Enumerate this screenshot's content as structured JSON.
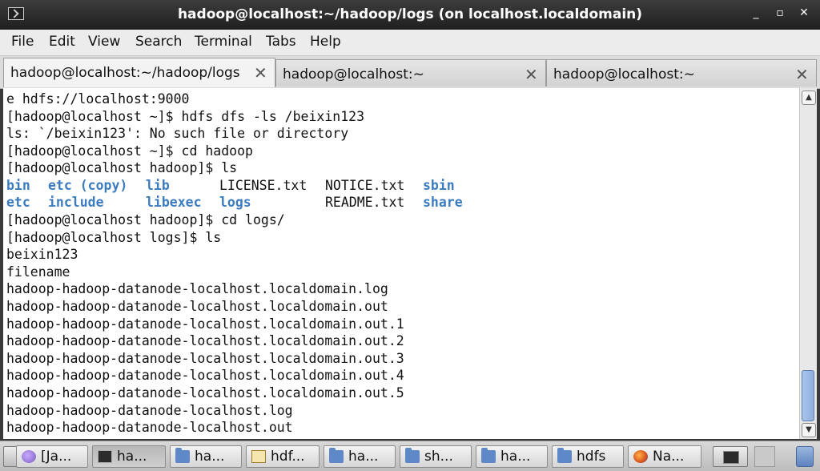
{
  "window": {
    "title": "hadoop@localhost:~/hadoop/logs (on localhost.localdomain)",
    "minimize": "_",
    "maximize": "▫",
    "close": "✕"
  },
  "menu": [
    "File",
    "Edit",
    "View",
    "Search",
    "Terminal",
    "Tabs",
    "Help"
  ],
  "tabs": [
    {
      "label": "hadoop@localhost:~/hadoop/logs",
      "close": "✕"
    },
    {
      "label": "hadoop@localhost:~",
      "close": "✕"
    },
    {
      "label": "hadoop@localhost:~",
      "close": "✕"
    }
  ],
  "terminal": {
    "lines": [
      "e hdfs://localhost:9000",
      "[hadoop@localhost ~]$ hdfs dfs -ls /beixin123",
      "ls: `/beixin123': No such file or directory",
      "[hadoop@localhost ~]$ cd hadoop",
      "[hadoop@localhost hadoop]$ ls"
    ],
    "ls_row1": {
      "a": "bin",
      "b": "etc (copy)",
      "c": "lib",
      "d": "LICENSE.txt",
      "e": "NOTICE.txt",
      "f": "sbin"
    },
    "ls_row2": {
      "a": "etc",
      "b": "include",
      "c": "libexec",
      "d": "logs",
      "e": "README.txt",
      "f": "share"
    },
    "lines2": [
      "[hadoop@localhost hadoop]$ cd logs/",
      "[hadoop@localhost logs]$ ls",
      "beixin123",
      "filename",
      "hadoop-hadoop-datanode-localhost.localdomain.log",
      "hadoop-hadoop-datanode-localhost.localdomain.out",
      "hadoop-hadoop-datanode-localhost.localdomain.out.1",
      "hadoop-hadoop-datanode-localhost.localdomain.out.2",
      "hadoop-hadoop-datanode-localhost.localdomain.out.3",
      "hadoop-hadoop-datanode-localhost.localdomain.out.4",
      "hadoop-hadoop-datanode-localhost.localdomain.out.5",
      "hadoop-hadoop-datanode-localhost.log",
      "hadoop-hadoop-datanode-localhost.out"
    ],
    "colors": {
      "directory": "#3b7bbf",
      "text": "#111111",
      "background": "#ffffff"
    }
  },
  "scrollbar": {
    "up": "▲",
    "down": "▼"
  },
  "taskbar": [
    {
      "label": "[Ja...",
      "icon": "java-icon"
    },
    {
      "label": "ha...",
      "icon": "terminal-icon"
    },
    {
      "label": "ha...",
      "icon": "folder-icon"
    },
    {
      "label": "hdf...",
      "icon": "text-editor-icon"
    },
    {
      "label": "ha...",
      "icon": "folder-icon"
    },
    {
      "label": "sh...",
      "icon": "folder-icon"
    },
    {
      "label": "ha...",
      "icon": "folder-icon"
    },
    {
      "label": "hdfs",
      "icon": "folder-icon"
    },
    {
      "label": "Na...",
      "icon": "firefox-icon"
    }
  ]
}
